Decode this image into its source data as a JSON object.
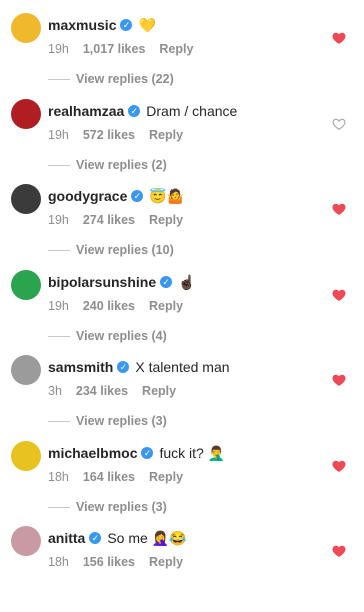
{
  "comments": [
    {
      "username": "maxmusic",
      "text": "💛",
      "time": "19h",
      "likes": "1,017 likes",
      "reply": "Reply",
      "replies": "View replies (22)",
      "liked": true,
      "avatar": "#f0b82c"
    },
    {
      "username": "realhamzaa",
      "text": "Dram / chance",
      "time": "19h",
      "likes": "572 likes",
      "reply": "Reply",
      "replies": "View replies (2)",
      "liked": false,
      "avatar": "#b01d22"
    },
    {
      "username": "goodygrace",
      "text": "😇🤷",
      "time": "19h",
      "likes": "274 likes",
      "reply": "Reply",
      "replies": "View replies (10)",
      "liked": true,
      "avatar": "#3b3b3b"
    },
    {
      "username": "bipolarsunshine",
      "text": "☝🏿",
      "time": "19h",
      "likes": "240 likes",
      "reply": "Reply",
      "replies": "View replies (4)",
      "liked": true,
      "avatar": "#2aa44f"
    },
    {
      "username": "samsmith",
      "text": "X talented man",
      "time": "3h",
      "likes": "234 likes",
      "reply": "Reply",
      "replies": "View replies (3)",
      "liked": true,
      "avatar": "#9b9b9b"
    },
    {
      "username": "michaelbmoc",
      "text": "fuck it? 🤦‍♂️",
      "time": "18h",
      "likes": "164 likes",
      "reply": "Reply",
      "replies": "View replies (3)",
      "liked": true,
      "avatar": "#e8c21f"
    },
    {
      "username": "anitta",
      "text": "So me 🤦‍♀️😂",
      "time": "18h",
      "likes": "156 likes",
      "reply": "Reply",
      "replies": "",
      "liked": true,
      "avatar": "#c89aa3"
    }
  ],
  "colors": {
    "liked": "#ed4956",
    "unliked": "#c7c7c7",
    "verified": "#3897f0",
    "muted": "#8e8e8e"
  }
}
